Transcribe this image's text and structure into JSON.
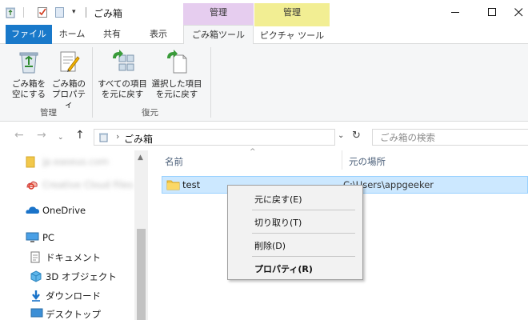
{
  "window": {
    "title": "ごみ箱",
    "context_header_1": "管理",
    "context_header_2": "管理"
  },
  "tabs": {
    "file": "ファイル",
    "home": "ホーム",
    "share": "共有",
    "view": "表示",
    "recycle_bin_tools": "ごみ箱ツール",
    "picture_tools": "ピクチャ ツール"
  },
  "ribbon": {
    "empty_bin_l1": "ごみ箱を",
    "empty_bin_l2": "空にする",
    "properties_l1": "ごみ箱の",
    "properties_l2": "プロパティ",
    "group_manage": "管理",
    "restore_all_l1": "すべての項目",
    "restore_all_l2": "を元に戻す",
    "restore_sel_l1": "選択した項目",
    "restore_sel_l2": "を元に戻す",
    "group_restore": "復元"
  },
  "address": {
    "path": "ごみ箱",
    "search_placeholder": "ごみ箱の検索"
  },
  "nav": {
    "items": [
      {
        "label": "jp.easeus.com",
        "blurred": true
      },
      {
        "label": "Creative Cloud Files",
        "blurred": true
      },
      {
        "label": "OneDrive",
        "blurred": false
      },
      {
        "label": "PC",
        "blurred": false
      },
      {
        "label": "ドキュメント",
        "blurred": false
      },
      {
        "label": "3D オブジェクト",
        "blurred": false
      },
      {
        "label": "ダウンロード",
        "blurred": false
      },
      {
        "label": "デスクトップ",
        "blurred": false
      }
    ]
  },
  "filelist": {
    "col_name": "名前",
    "col_location": "元の場所",
    "row": {
      "name": "test",
      "location": "C:\\Users\\appgeeker"
    }
  },
  "context_menu": {
    "restore": "元に戻す(E)",
    "cut": "切り取り(T)",
    "delete": "削除(D)",
    "properties": "プロパティ(R)"
  },
  "colors": {
    "file_tab": "#1979ca",
    "manage_header_1": "#e6cdef",
    "manage_header_2": "#f2ee93",
    "selection": "#cce8ff"
  }
}
